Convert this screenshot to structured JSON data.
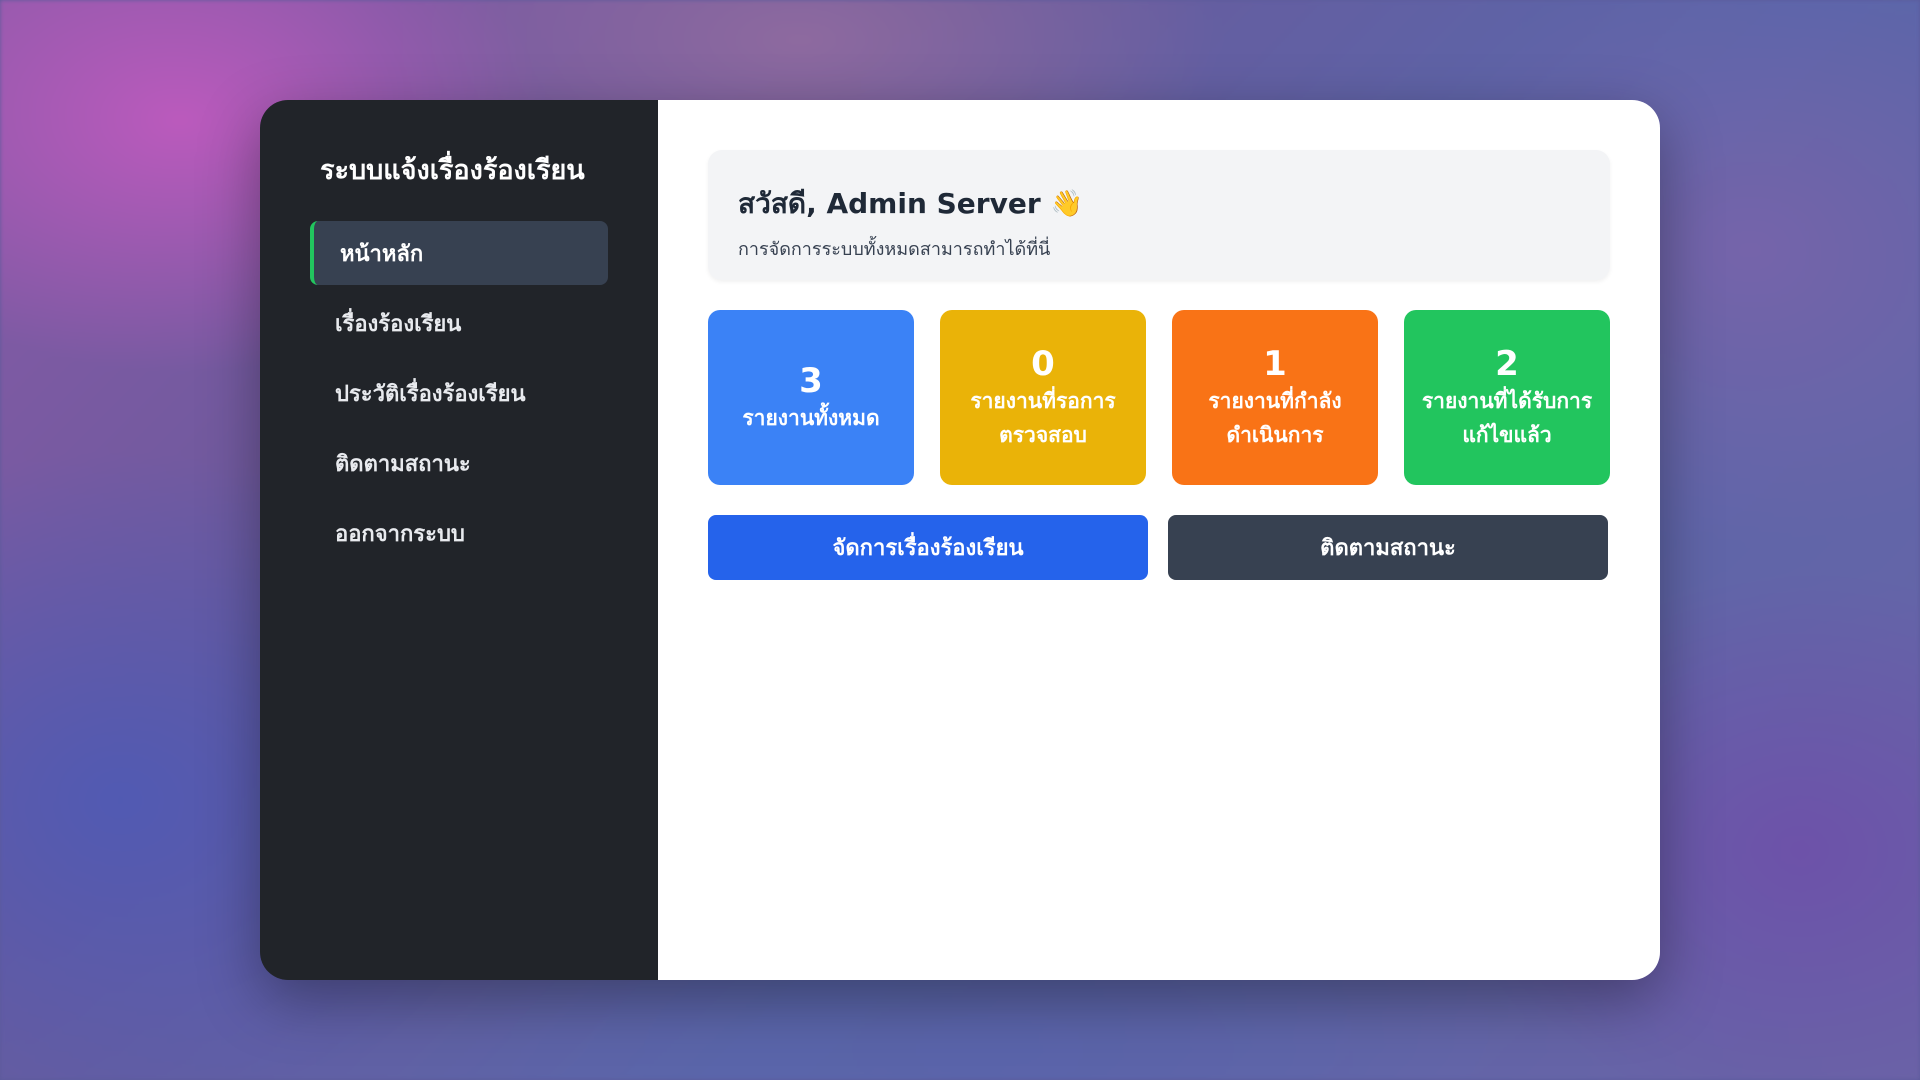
{
  "sidebar": {
    "title": "ระบบแจ้งเรื่องร้องเรียน",
    "items": [
      {
        "label": "หน้าหลัก",
        "active": true
      },
      {
        "label": "เรื่องร้องเรียน",
        "active": false
      },
      {
        "label": "ประวัติเรื่องร้องเรียน",
        "active": false
      },
      {
        "label": "ติดตามสถานะ",
        "active": false
      },
      {
        "label": "ออกจากระบบ",
        "active": false
      }
    ]
  },
  "welcome": {
    "title": "สวัสดี, Admin Server",
    "icon": "waving-hand-icon",
    "icon_glyph": "👋",
    "subtitle": "การจัดการระบบทั้งหมดสามารถทำได้ที่นี่"
  },
  "stats": [
    {
      "value": "3",
      "label": "รายงานทั้งหมด",
      "color": "#3b82f6"
    },
    {
      "value": "0",
      "label": "รายงานที่รอการตรวจสอบ",
      "color": "#eab308"
    },
    {
      "value": "1",
      "label": "รายงานที่กำลังดำเนินการ",
      "color": "#f97316"
    },
    {
      "value": "2",
      "label": "รายงานที่ได้รับการแก้ไขแล้ว",
      "color": "#22c55e"
    }
  ],
  "actions": {
    "manage_label": "จัดการเรื่องร้องเรียน",
    "manage_color": "#2563eb",
    "track_label": "ติดตามสถานะ",
    "track_color": "#374151"
  },
  "colors": {
    "sidebar_bg": "#212429",
    "active_item_bg": "#374151",
    "active_indicator": "#22c55e"
  }
}
